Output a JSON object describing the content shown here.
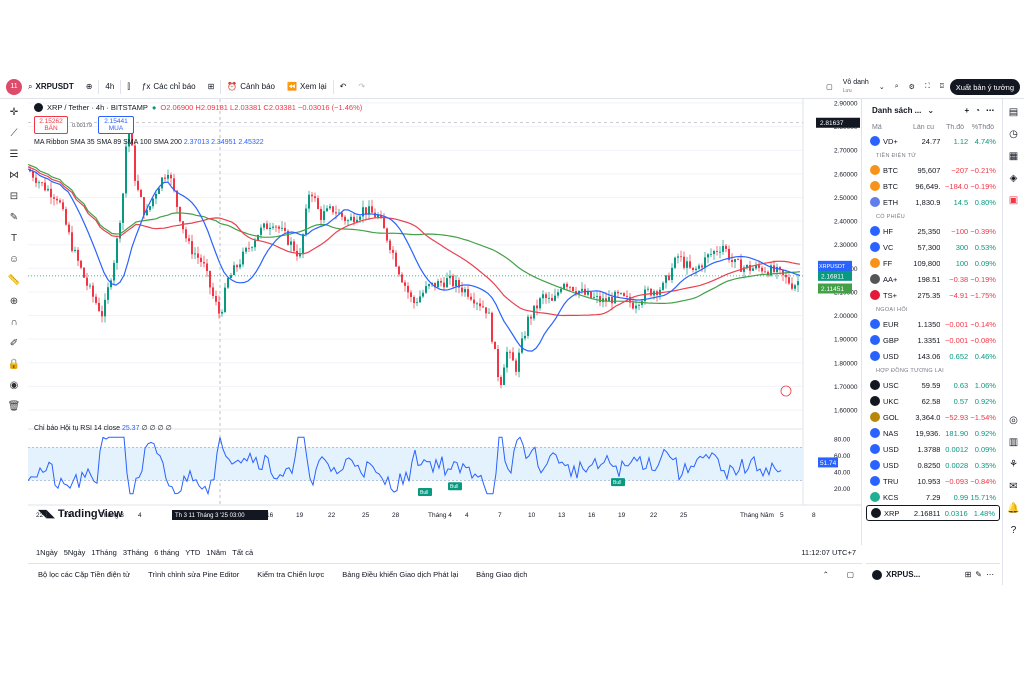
{
  "toolbar": {
    "logo_badge": "11",
    "symbol": "XRPUSDT",
    "interval": "4h",
    "indicators_label": "Các chỉ báo",
    "alerts_label": "Cảnh báo",
    "replay_label": "Xem lại",
    "layout_name": "Vô danh",
    "layout_sub": "Lưu",
    "publish_label": "Xuất bản ý tưởng"
  },
  "legend": {
    "title": "XRP / Tether · 4h · BITSTAMP",
    "ohlc": "O2.06900 H2.09181 L2.03381 C2.03381 −0.03016 (−1.46%)",
    "sell_price": "2.15262",
    "sell_label": "BÁN",
    "buy_price": "2.15441",
    "buy_label": "MUA",
    "spread": "0.00179",
    "ma_label": "MA Ribbon SMA 35 SMA 89 SMA 100 SMA 200",
    "ma_values": "2.37013  2.34951  2.45322"
  },
  "rsi": {
    "label": "Chỉ báo Hội tụ RSI 14 close",
    "value": "25.37",
    "placeholders": "∅ ∅ ∅ ∅",
    "current": "51.74",
    "bull_label": "Bull"
  },
  "price_axis": {
    "ticks": [
      "2.90000",
      "2.80000",
      "2.70000",
      "2.60000",
      "2.50000",
      "2.40000",
      "2.30000",
      "2.20000",
      "2.10000",
      "2.00000",
      "1.90000",
      "1.80000",
      "1.70000",
      "1.60000"
    ],
    "crosshair_price": "2.81637",
    "tag_red": "2.19932",
    "tag_blue": "2.17867",
    "tag_symbol": "XRPUSDT",
    "tag_last": "2.16811",
    "tag_green": "2.11451",
    "rsi_ticks": [
      "80.00",
      "60.00",
      "40.00",
      "20.00"
    ]
  },
  "time_axis": {
    "labels": [
      "22",
      "25",
      "Tháng 3",
      "4",
      "16",
      "19",
      "22",
      "25",
      "28",
      "Tháng 4",
      "4",
      "7",
      "10",
      "13",
      "16",
      "19",
      "22",
      "25",
      "Tháng Năm",
      "5",
      "8"
    ],
    "crosshair_time": "Th 3 11 Tháng 3 '25  03:00"
  },
  "branding": "TradingView",
  "ranges": [
    "1Ngày",
    "5Ngày",
    "1Tháng",
    "3Tháng",
    "6 tháng",
    "YTD",
    "1Năm",
    "Tất cả"
  ],
  "clock": "11:12:07 UTC+7",
  "bottom_tabs": [
    "Bộ lọc các Cặp Tiền điện tử",
    "Trình chỉnh sửa Pine Editor",
    "Kiểm tra Chiến lược",
    "Bảng Điều khiển Giao dịch Phát lại",
    "Bảng Giao dịch"
  ],
  "watchlist": {
    "title": "Danh sách ...",
    "cols": [
      "Mã",
      "Lần cu",
      "Th.đổ",
      "%Thđổ"
    ],
    "footer_symbol": "XRPUS...",
    "sections": [
      {
        "name": "",
        "rows": [
          {
            "sym": "VD+",
            "last": "24.77",
            "chg": "1.12",
            "pct": "4.74%",
            "dir": "up",
            "color": "#2962ff"
          }
        ]
      },
      {
        "name": "TIỀN ĐIỆN TỬ",
        "rows": [
          {
            "sym": "BTC",
            "last": "95,607",
            "chg": "−207",
            "pct": "−0.21%",
            "dir": "down",
            "color": "#f7931a"
          },
          {
            "sym": "BTC",
            "last": "96,649.",
            "chg": "−184.0",
            "pct": "−0.19%",
            "dir": "down",
            "color": "#f7931a"
          },
          {
            "sym": "ETH",
            "last": "1,830.9",
            "chg": "14.5",
            "pct": "0.80%",
            "dir": "up",
            "color": "#627eea"
          }
        ]
      },
      {
        "name": "CỔ PHIẾU",
        "rows": [
          {
            "sym": "HF",
            "last": "25,350",
            "chg": "−100",
            "pct": "−0.39%",
            "dir": "down",
            "color": "#2962ff"
          },
          {
            "sym": "VC",
            "last": "57,300",
            "chg": "300",
            "pct": "0.53%",
            "dir": "up",
            "color": "#2962ff"
          },
          {
            "sym": "FF",
            "last": "109,800",
            "chg": "100",
            "pct": "0.09%",
            "dir": "up",
            "color": "#f7931a"
          },
          {
            "sym": "AA+",
            "last": "198.51",
            "chg": "−0.38",
            "pct": "−0.19%",
            "dir": "down",
            "color": "#555555"
          },
          {
            "sym": "TS+",
            "last": "275.35",
            "chg": "−4.91",
            "pct": "−1.75%",
            "dir": "down",
            "color": "#e31937"
          }
        ]
      },
      {
        "name": "NGOẠI HỐI",
        "rows": [
          {
            "sym": "EUR",
            "last": "1.1350",
            "chg": "−0.001",
            "pct": "−0.14%",
            "dir": "down",
            "color": "#2962ff"
          },
          {
            "sym": "GBP",
            "last": "1.3351",
            "chg": "−0.001",
            "pct": "−0.08%",
            "dir": "down",
            "color": "#2962ff"
          },
          {
            "sym": "USD",
            "last": "143.06",
            "chg": "0.652",
            "pct": "0.46%",
            "dir": "up",
            "color": "#2962ff"
          }
        ]
      },
      {
        "name": "HỢP ĐỒNG TƯƠNG LAI",
        "rows": [
          {
            "sym": "USC",
            "last": "59.59",
            "chg": "0.63",
            "pct": "1.06%",
            "dir": "up",
            "color": "#131722"
          },
          {
            "sym": "UKC",
            "last": "62.58",
            "chg": "0.57",
            "pct": "0.92%",
            "dir": "up",
            "color": "#131722"
          },
          {
            "sym": "GOL",
            "last": "3,364.0",
            "chg": "−52.93",
            "pct": "−1.54%",
            "dir": "down",
            "color": "#b8860b"
          },
          {
            "sym": "NAS",
            "last": "19,936.",
            "chg": "181.90",
            "pct": "0.92%",
            "dir": "up",
            "color": "#2962ff"
          },
          {
            "sym": "USD",
            "last": "1.3788",
            "chg": "0.0012",
            "pct": "0.09%",
            "dir": "up",
            "color": "#2962ff"
          },
          {
            "sym": "USD",
            "last": "0.8250",
            "chg": "0.0028",
            "pct": "0.35%",
            "dir": "up",
            "color": "#2962ff"
          },
          {
            "sym": "TRU",
            "last": "10.953",
            "chg": "−0.093",
            "pct": "−0.84%",
            "dir": "down",
            "color": "#2962ff"
          },
          {
            "sym": "KCS",
            "last": "7.29",
            "chg": "0.99",
            "pct": "15.71%",
            "dir": "up",
            "color": "#23af91"
          },
          {
            "sym": "XRP",
            "last": "2.16811",
            "chg": "0.0316",
            "pct": "1.48%",
            "dir": "up",
            "color": "#131722",
            "selected": true
          }
        ]
      }
    ]
  },
  "colors": {
    "up": "#089981",
    "down": "#f23645",
    "sma_blue": "#2962ff",
    "sma_red": "#e8424f",
    "sma_green": "#43a047",
    "rsi_band": "#e3f2fd"
  }
}
